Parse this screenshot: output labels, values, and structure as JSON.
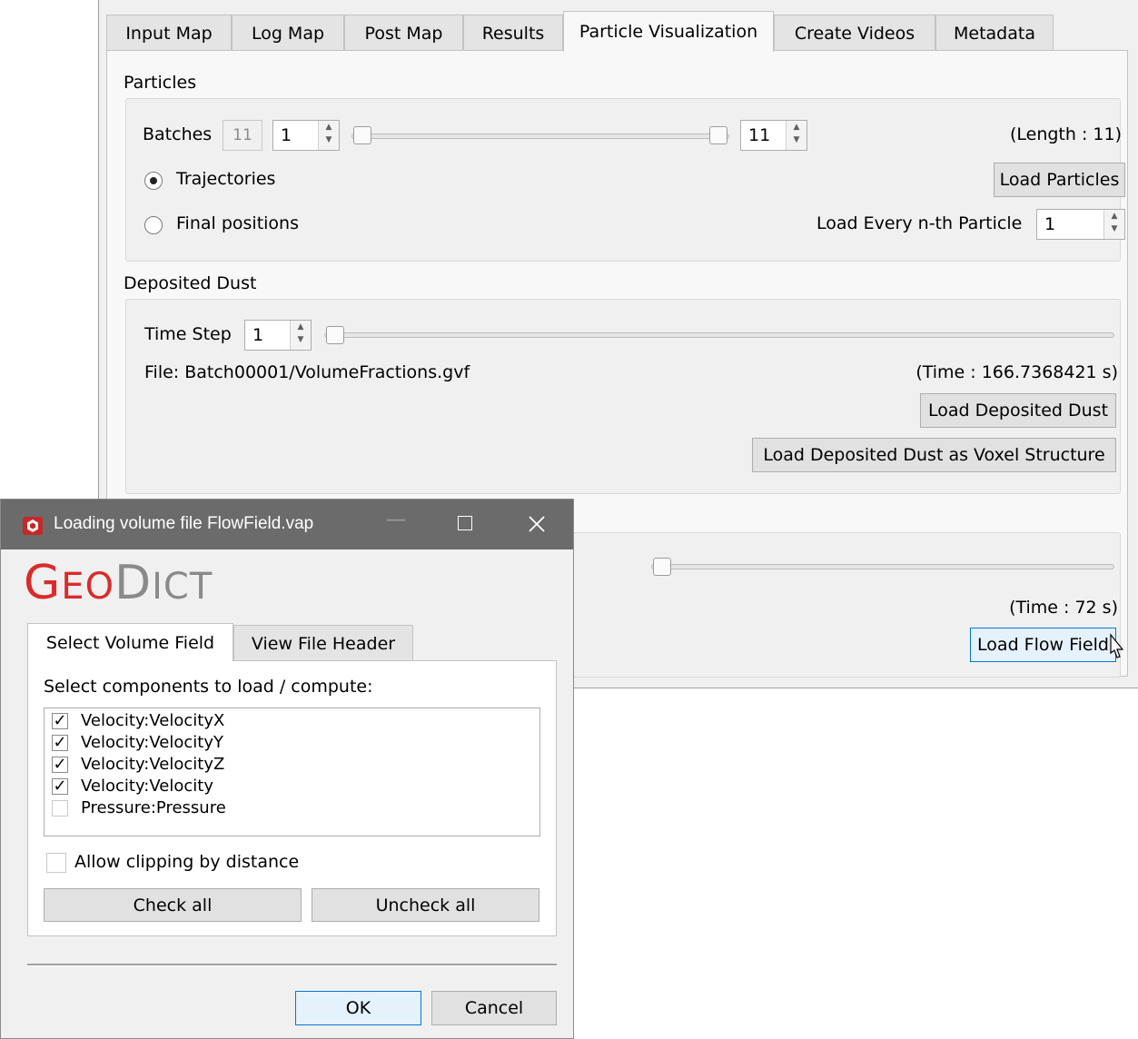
{
  "tabs": [
    {
      "label": "Input Map"
    },
    {
      "label": "Log Map"
    },
    {
      "label": "Post Map"
    },
    {
      "label": "Results"
    },
    {
      "label": "Particle Visualization"
    },
    {
      "label": "Create Videos"
    },
    {
      "label": "Metadata"
    }
  ],
  "particles": {
    "title": "Particles",
    "batches_label": "Batches",
    "batches_count": "11",
    "batch_from": "1",
    "batch_to": "11",
    "length_text": "(Length : 11)",
    "trajectories_label": "Trajectories",
    "final_positions_label": "Final positions",
    "load_particles_label": "Load Particles",
    "load_every_label": "Load Every n-th Particle",
    "load_every_value": "1",
    "selected_mode": "Trajectories"
  },
  "deposited_dust": {
    "title": "Deposited Dust",
    "time_step_label": "Time Step",
    "time_step_value": "1",
    "file_text": "File: Batch00001/VolumeFractions.gvf",
    "time_text": "(Time : 166.7368421 s)",
    "load_button": "Load Deposited Dust",
    "load_voxel_button": "Load Deposited Dust as Voxel Structure"
  },
  "flow_field": {
    "time_text": "(Time : 72 s)",
    "load_button": "Load Flow Field"
  },
  "dialog": {
    "title": "Loading volume file FlowField.vap",
    "logo": {
      "part1": "G",
      "part2": "EO",
      "part3": "D",
      "part4": "ICT"
    },
    "colors": {
      "logo_red": "#d92b2b",
      "logo_gray": "#8a8a8a",
      "app_icon_red": "#c62828"
    },
    "tabs": [
      {
        "label": "Select Volume Field"
      },
      {
        "label": "View File Header"
      }
    ],
    "select_label": "Select components to load / compute:",
    "components": [
      {
        "label": "Velocity:VelocityX",
        "checked": true
      },
      {
        "label": "Velocity:VelocityY",
        "checked": true
      },
      {
        "label": "Velocity:VelocityZ",
        "checked": true
      },
      {
        "label": "Velocity:Velocity",
        "checked": true
      },
      {
        "label": "Pressure:Pressure",
        "checked": false
      }
    ],
    "allow_clipping_label": "Allow clipping by distance",
    "check_all_label": "Check all",
    "uncheck_all_label": "Uncheck all",
    "ok_label": "OK",
    "cancel_label": "Cancel"
  }
}
